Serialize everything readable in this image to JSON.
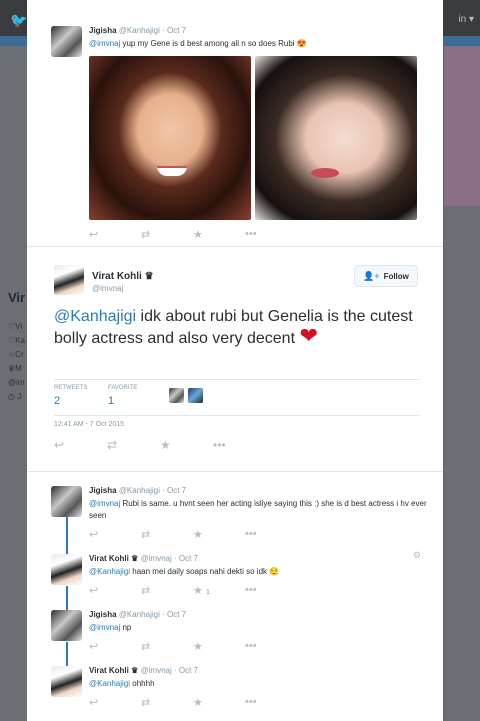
{
  "background": {
    "logo": "🐦",
    "menu_label": "in ▾",
    "profile_name": "Vir",
    "side_items": [
      "♡Vi",
      "♡Ka",
      "☆Cr",
      "♛M",
      "@im",
      "◷ J"
    ]
  },
  "top_tweet": {
    "name": "Jigisha",
    "handle": "@Kanhajigi",
    "time": "· Oct 7",
    "mention": "@imvnaj",
    "text": " yup my Gene is d best among all n so does Rubi 😍"
  },
  "main_tweet": {
    "name": "Virat Kohli",
    "name_icon": "♛",
    "handle": "@imvnaj",
    "follow_label": "Follow",
    "mention": "@Kanhajigi",
    "text": " idk about rubi but Genelia is the cutest bolly actress and also very decent ",
    "heart": "❤",
    "retweets_label": "RETWEETS",
    "retweets_count": "2",
    "favorites_label": "FAVORITE",
    "favorites_count": "1",
    "timestamp": "12:41 AM - 7 Oct 2015"
  },
  "replies": [
    {
      "name": "Jigisha",
      "handle": "@Kanhajigi",
      "time": "· Oct 7",
      "mention": "@imvnaj",
      "text": " Rubi is same. u hvnt seen her acting isliye saying this :) she is d best actress i hv ever seen",
      "fav_count": ""
    },
    {
      "name": "Virat Kohli ♛",
      "handle": "@imvnaj",
      "time": "· Oct 7",
      "mention": "@Kanhajigi",
      "text": " haan mei daily soaps nahi dekti so idk 😌",
      "fav_count": "1"
    },
    {
      "name": "Jigisha",
      "handle": "@Kanhajigi",
      "time": "· Oct 7",
      "mention": "@imvnaj",
      "text": " np",
      "fav_count": ""
    },
    {
      "name": "Virat Kohli ♛",
      "handle": "@imvnaj",
      "time": "· Oct 7",
      "mention": "@Kanhajigi",
      "text": " ohhhh",
      "fav_count": ""
    }
  ],
  "icons": {
    "reply": "↩",
    "retweet": "⇄",
    "favorite": "★",
    "more": "•••",
    "follow": "👤+",
    "gear": "⚙"
  }
}
